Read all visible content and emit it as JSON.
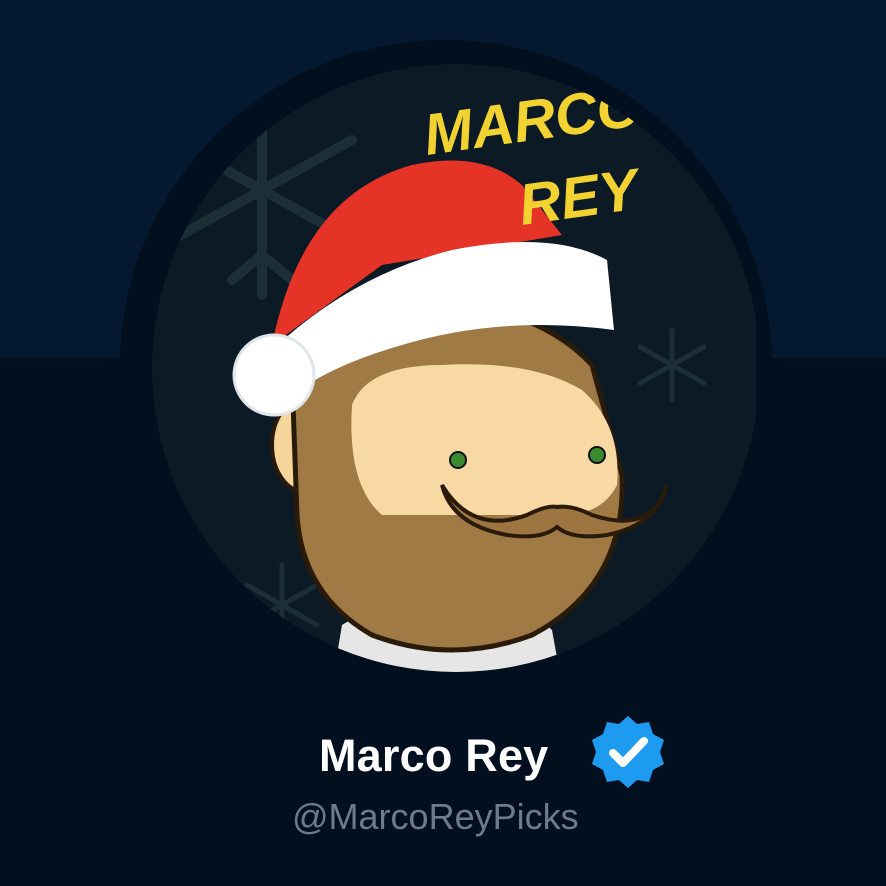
{
  "profile": {
    "display_name": "Marco Rey",
    "handle": "@MarcoReyPicks",
    "verified": true,
    "verified_icon": "verified-badge-icon",
    "avatar_text_line1": "MARCO",
    "avatar_text_line2": "REY"
  },
  "colors": {
    "banner": "#04182f",
    "background": "#020f1e",
    "name": "#ffffff",
    "handle": "#6e7b88",
    "verified": "#1d9bf0",
    "avatar_title": "#f2d230"
  }
}
